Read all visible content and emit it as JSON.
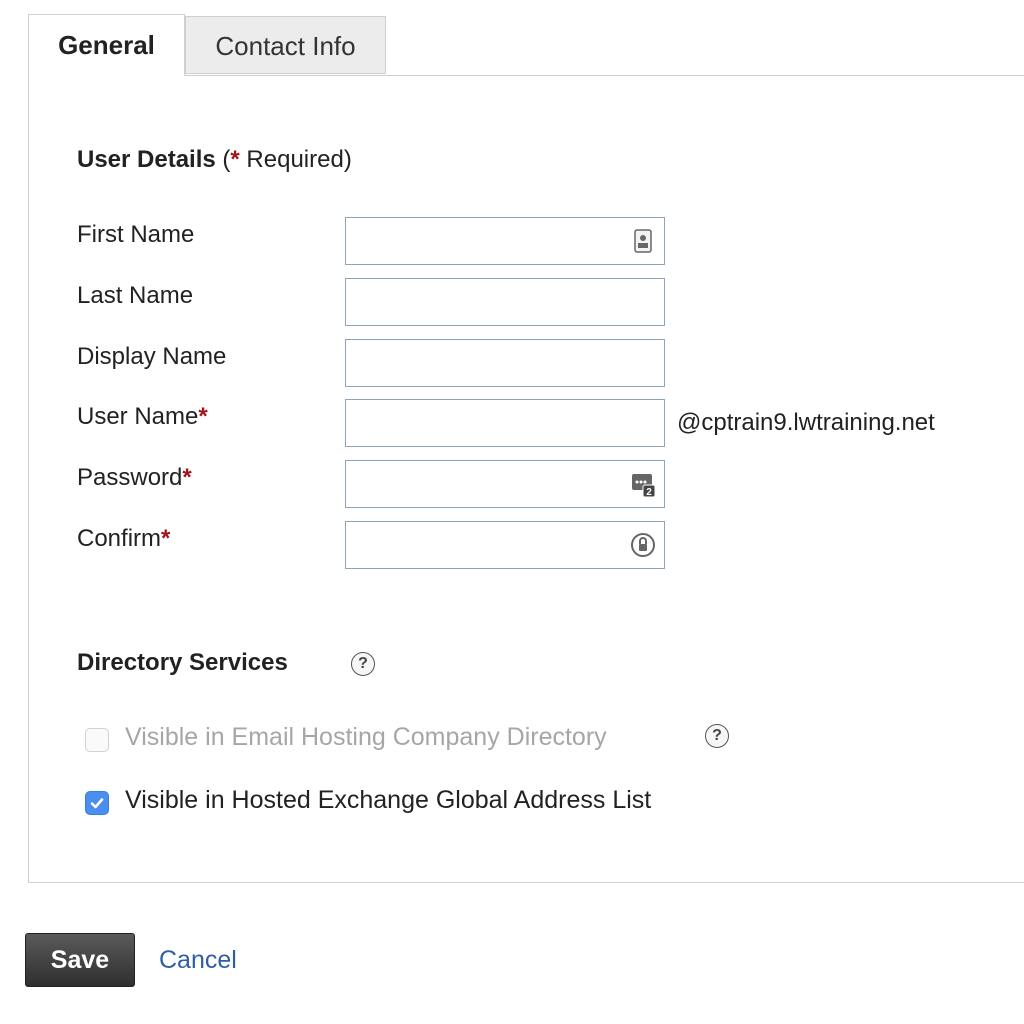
{
  "tabs": [
    {
      "label": "General",
      "active": true
    },
    {
      "label": "Contact Info",
      "active": false
    }
  ],
  "user_details": {
    "title": "User Details",
    "open_paren": "(",
    "asterisk": "*",
    "required_text": " Required)"
  },
  "fields": [
    {
      "label": "First Name",
      "required": false,
      "value": "",
      "icon": "contact-card-icon"
    },
    {
      "label": "Last Name",
      "required": false,
      "value": ""
    },
    {
      "label": "Display Name",
      "required": false,
      "value": ""
    },
    {
      "label": "User Name",
      "required": true,
      "value": "",
      "suffix": "@cptrain9.lwtraining.net"
    },
    {
      "label": "Password",
      "required": true,
      "value": "",
      "icon": "password-generator-icon"
    },
    {
      "label": "Confirm",
      "required": true,
      "value": "",
      "icon": "password-lock-icon"
    }
  ],
  "directory_services": {
    "title": "Directory Services",
    "help": "?",
    "options": [
      {
        "label": "Visible in Email Hosting Company Directory",
        "checked": false,
        "disabled": true,
        "help": "?"
      },
      {
        "label": "Visible in Hosted Exchange Global Address List",
        "checked": true,
        "disabled": false
      }
    ]
  },
  "actions": {
    "save_label": "Save",
    "cancel_label": "Cancel"
  },
  "colors": {
    "required": "#a0141e",
    "checkbox_checked": "#4a8ef0",
    "link": "#2f5ea8",
    "field_border": "#8ea4bd"
  }
}
